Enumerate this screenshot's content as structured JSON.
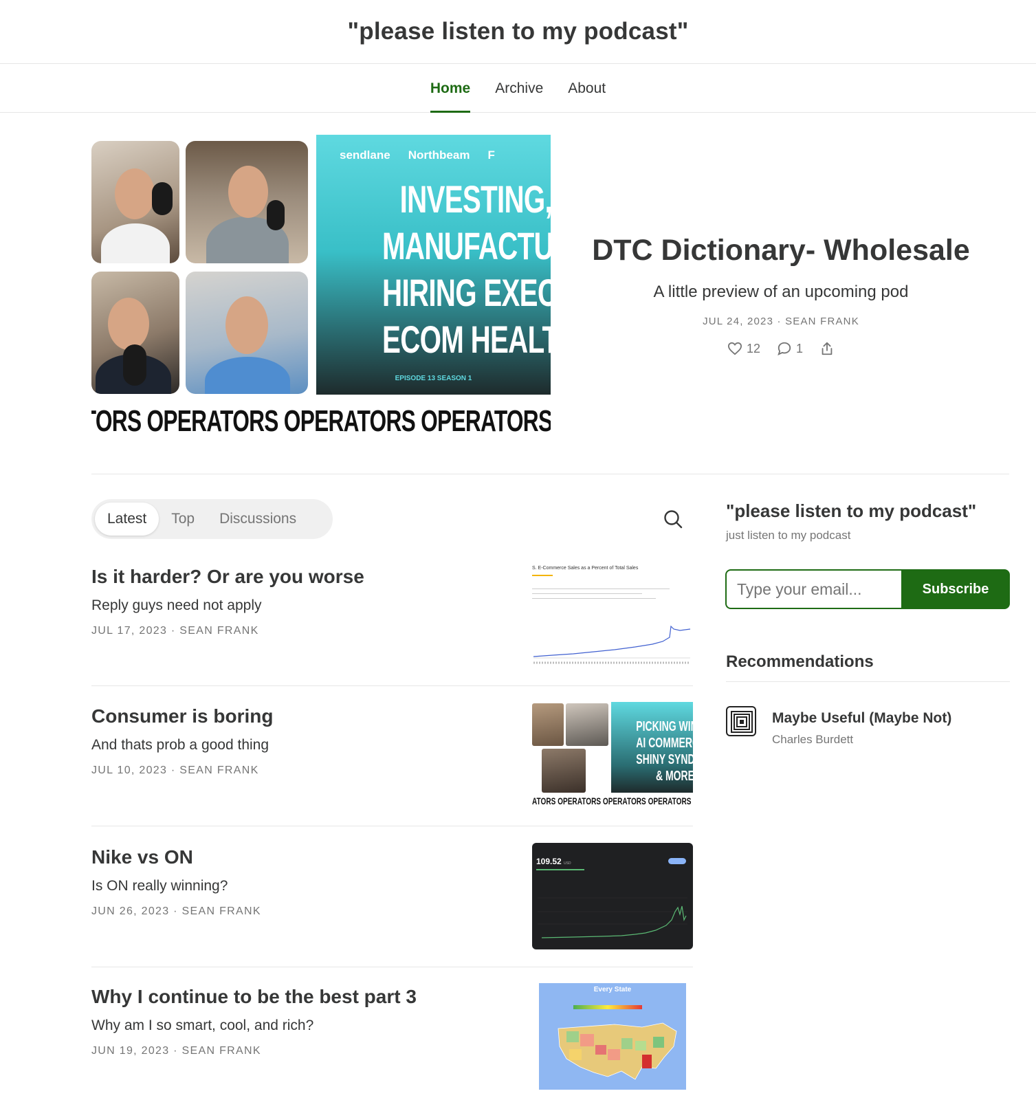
{
  "site": {
    "title": "\"please listen to my podcast\""
  },
  "nav": {
    "items": [
      {
        "label": "Home"
      },
      {
        "label": "Archive"
      },
      {
        "label": "About"
      }
    ]
  },
  "hero": {
    "image": {
      "logos": [
        "sendlane",
        "Northbeam",
        "F"
      ],
      "lines": [
        "INVESTING,",
        "MANUFACTURING",
        "HIRING EXECUTIVE",
        "ECOM HEALTH"
      ],
      "episode": "EPISODE 13 SEASON 1",
      "banner": "ATORS OPERATORS OPERATORS OPERATORS OPERA"
    },
    "title": "DTC Dictionary- Wholesale",
    "subtitle": "A little preview of an upcoming pod",
    "meta": "JUL 24, 2023 · SEAN FRANK",
    "likes": "12",
    "comments": "1"
  },
  "tabs": [
    {
      "label": "Latest"
    },
    {
      "label": "Top"
    },
    {
      "label": "Discussions"
    }
  ],
  "posts": [
    {
      "title": "Is it harder? Or are you worse",
      "subtitle": "Reply guys need not apply",
      "meta": "JUL 17, 2023 · SEAN FRANK",
      "thumb_caption": "S. E-Commerce Sales as a Percent of Total Sales"
    },
    {
      "title": "Consumer is boring",
      "subtitle": "And thats prob a good thing",
      "meta": "JUL 10, 2023 · SEAN FRANK",
      "thumb_lines": [
        "PICKING WINNER",
        "AI COMMERCE,",
        "SHINY SYNDROM",
        "& MORE"
      ],
      "thumb_banner": "ATORS OPERATORS OPERATORS OPERATORS OPERA"
    },
    {
      "title": "Nike vs ON",
      "subtitle": "Is ON really winning?",
      "meta": "JUN 26, 2023 · SEAN FRANK",
      "thumb_value": "109.52",
      "thumb_currency": "USD"
    },
    {
      "title": "Why I continue to be the best part 3",
      "subtitle": "Why am I so smart, cool, and rich?",
      "meta": "JUN 19, 2023 · SEAN FRANK",
      "thumb_caption": "Every State"
    }
  ],
  "sidebar": {
    "title": "\"please listen to my podcast\"",
    "description": "just listen to my podcast",
    "email_placeholder": "Type your email...",
    "subscribe_label": "Subscribe",
    "recommendations_heading": "Recommendations",
    "recommendations": [
      {
        "name": "Maybe Useful (Maybe Not)",
        "author": "Charles Burdett"
      }
    ]
  },
  "colors": {
    "accent": "#1e6b14",
    "text": "#363737",
    "muted": "#757575"
  }
}
